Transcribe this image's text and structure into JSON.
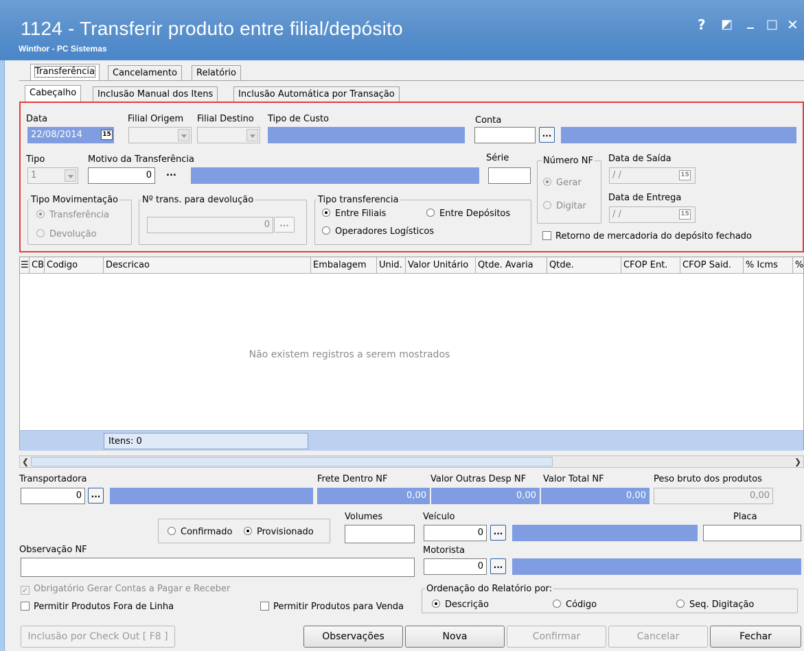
{
  "window": {
    "title": "1124 - Transferir produto entre filial/depósito",
    "subtitle": "Winthor - PC Sistemas",
    "controls": {
      "help": "?",
      "restore": "◩",
      "minimize": "_",
      "maximize": "□",
      "close": "✕"
    }
  },
  "top_tabs": [
    {
      "label": "Transferência",
      "active": true
    },
    {
      "label": "Cancelamento",
      "active": false
    },
    {
      "label": "Relatório",
      "active": false
    }
  ],
  "sub_tabs": [
    {
      "label": "Cabeçalho",
      "active": true
    },
    {
      "label": "Inclusão Manual dos Itens",
      "active": false
    },
    {
      "label": "Inclusão Automática por Transação",
      "active": false
    }
  ],
  "header": {
    "data_label": "Data",
    "data_value": "22/08/2014",
    "filial_origem_label": "Filial Origem",
    "filial_destino_label": "Filial Destino",
    "tipo_custo_label": "Tipo de Custo",
    "conta_label": "Conta",
    "tipo_label": "Tipo",
    "tipo_value": "1",
    "motivo_label": "Motivo da Transferência",
    "motivo_value": "0",
    "motivo_dots": "...",
    "serie_label": "Série",
    "numero_nf_label": "Número NF",
    "numero_nf_options": [
      "Gerar",
      "Digitar"
    ],
    "data_saida_label": "Data de Saída",
    "data_saida_value": "/ /",
    "data_entrega_label": "Data de Entrega",
    "data_entrega_value": "/ /",
    "tipo_movimentacao_label": "Tipo Movimentação",
    "tipo_movimentacao_options": [
      "Transferência",
      "Devolução"
    ],
    "ntrans_label": "Nº trans. para devolução",
    "ntrans_value": "0",
    "tipo_transferencia_label": "Tipo transferencia",
    "tipo_transferencia_options": [
      "Entre Filiais",
      "Entre Depósitos",
      "Operadores Logísticos"
    ],
    "retorno_label": "Retorno de mercadoria do depósito fechado",
    "dots": "...",
    "cal": "15"
  },
  "grid": {
    "columns": [
      "CB",
      "Codigo",
      "Descricao",
      "Embalagem",
      "Unid.",
      "Valor Unitário",
      "Qtde. Avaria",
      "Qtde.",
      "CFOP Ent.",
      "CFOP Said.",
      "% Icms",
      "%"
    ],
    "empty_message": "Não existem registros a serem mostrados",
    "items_label": "Itens: 0"
  },
  "footer": {
    "transportadora_label": "Transportadora",
    "transportadora_value": "0",
    "frete_label": "Frete Dentro NF",
    "frete_value": "0,00",
    "outras_label": "Valor Outras Desp NF",
    "outras_value": "0,00",
    "total_label": "Valor Total NF",
    "total_value": "0,00",
    "peso_label": "Peso bruto dos produtos",
    "peso_value": "0,00",
    "volumes_label": "Volumes",
    "veiculo_label": "Veículo",
    "veiculo_value": "0",
    "placa_label": "Placa",
    "status_options": [
      "Confirmado",
      "Provisionado"
    ],
    "obs_label": "Observação NF",
    "motorista_label": "Motorista",
    "motorista_value": "0",
    "obrigatorio_label": "Obrigatório Gerar Contas a Pagar e Receber",
    "permitir_fora_label": "Permitir Produtos Fora de Linha",
    "permitir_venda_label": "Permitir Produtos para Venda",
    "ordenacao_label": "Ordenação do Relatório por:",
    "ordenacao_options": [
      "Descrição",
      "Código",
      "Seq. Digitação"
    ]
  },
  "buttons": {
    "checkout": "Inclusão por Check Out  [ F8 ]",
    "observacoes": "Observações",
    "nova": "Nova",
    "confirmar": "Confirmar",
    "cancelar": "Cancelar",
    "fechar": "Fechar"
  }
}
